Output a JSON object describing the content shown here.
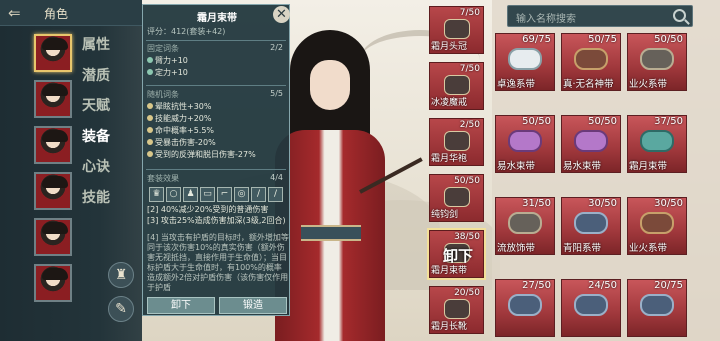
{
  "header": {
    "back_icon": "back-arrow-icon",
    "title": "角色"
  },
  "menu": {
    "items": [
      "属性",
      "潜质",
      "天赋",
      "装备",
      "心诀",
      "技能"
    ],
    "active": "装备"
  },
  "tools": [
    "armor-icon",
    "broom-icon"
  ],
  "detail": {
    "name": "霜月束带",
    "score": "评分：412(套装+42)",
    "fixed": {
      "title": "固定词条",
      "count": "2/2",
      "attrs": [
        "臂力+10",
        "定力+10"
      ]
    },
    "random": {
      "title": "随机词条",
      "count": "5/5",
      "attrs": [
        "晕眩抗性+30%",
        "技能威力+20%",
        "命中概率+5.5%",
        "受暴击伤害-20%",
        "受到的反弹和脱日伤害-27%"
      ]
    },
    "set": {
      "title": "套装效果",
      "count": "4/4",
      "lines": [
        "[2] 40%减少20%受到的普通伤害",
        "[3] 攻击25%造成伤害加深(3级,2回合)",
        "[4] 当攻击有护盾的目标时，额外增加等同于该次伤害10%的真实伤害（额外伤害无视抵挡，直接作用于生命值）；当目标护盾大于生命值时，有100%的概率造成额外2倍对护盾伤害（该伤害仅作用于护盾"
      ]
    },
    "buttons": {
      "unload": "卸下",
      "forge": "锻造"
    }
  },
  "equipped": [
    {
      "dur": "7/50",
      "name": "霜月头冠"
    },
    {
      "dur": "7/50",
      "name": "冰凌魔戒"
    },
    {
      "dur": "2/50",
      "name": "霜月华袍"
    },
    {
      "dur": "50/50",
      "name": "纯钧剑"
    },
    {
      "dur": "38/50",
      "name": "霜月束带"
    },
    {
      "dur": "20/50",
      "name": "霜月长靴"
    }
  ],
  "equipped_overlay": "卸下",
  "search": {
    "placeholder": "输入名称搜索"
  },
  "inventory": [
    {
      "dur": "69/75",
      "name": "卓逸系带"
    },
    {
      "dur": "50/75",
      "name": "真·无名神带"
    },
    {
      "dur": "50/50",
      "name": "业火系带"
    },
    {
      "dur": "50/50",
      "name": "易水束带"
    },
    {
      "dur": "50/50",
      "name": "易水束带"
    },
    {
      "dur": "37/50",
      "name": "霜月束带"
    },
    {
      "dur": "31/50",
      "name": "流放饰带"
    },
    {
      "dur": "30/50",
      "name": "青阳系带"
    },
    {
      "dur": "30/50",
      "name": "业火系带"
    },
    {
      "dur": "27/50",
      "name": ""
    },
    {
      "dur": "24/50",
      "name": ""
    },
    {
      "dur": "20/75",
      "name": ""
    }
  ]
}
